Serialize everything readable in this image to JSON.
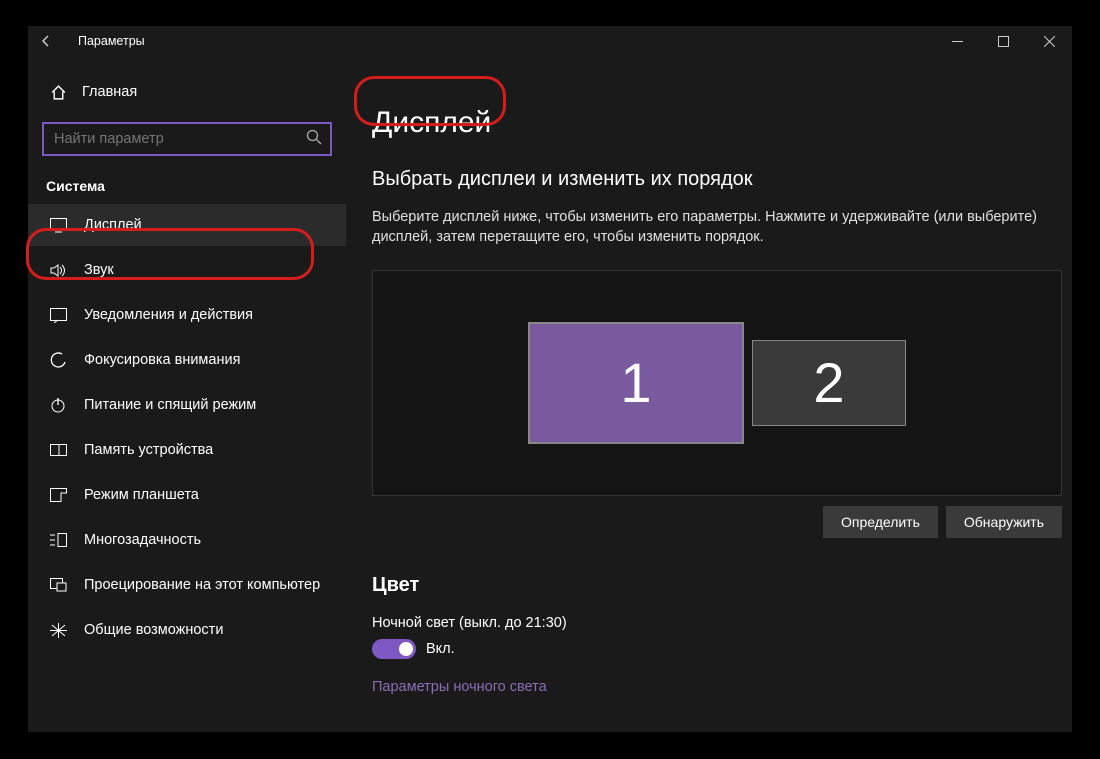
{
  "window": {
    "title": "Параметры"
  },
  "sidebar": {
    "home": "Главная",
    "search_placeholder": "Найти параметр",
    "section": "Система",
    "items": [
      {
        "label": "Дисплей"
      },
      {
        "label": "Звук"
      },
      {
        "label": "Уведомления и действия"
      },
      {
        "label": "Фокусировка внимания"
      },
      {
        "label": "Питание и спящий режим"
      },
      {
        "label": "Память устройства"
      },
      {
        "label": "Режим планшета"
      },
      {
        "label": "Многозадачность"
      },
      {
        "label": "Проецирование на этот компьютер"
      },
      {
        "label": "Общие возможности"
      }
    ]
  },
  "main": {
    "title": "Дисплей",
    "subtitle": "Выбрать дисплеи и изменить их порядок",
    "description": "Выберите дисплей ниже, чтобы изменить его параметры. Нажмите и удерживайте (или выберите) дисплей, затем перетащите его, чтобы изменить порядок.",
    "monitors": {
      "m1": "1",
      "m2": "2"
    },
    "identify": "Определить",
    "detect": "Обнаружить",
    "color_section": "Цвет",
    "night_light_label": "Ночной свет (выкл. до 21:30)",
    "toggle_state": "Вкл.",
    "night_light_link": "Параметры ночного света"
  }
}
